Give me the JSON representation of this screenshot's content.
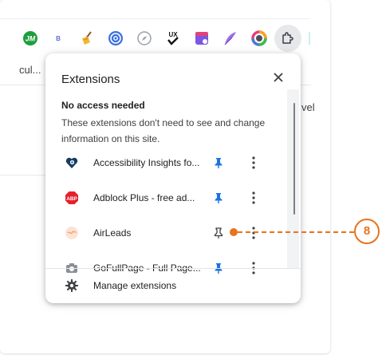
{
  "background_text": {
    "left_cut": "cul...",
    "right_cut": "vel"
  },
  "toolbar": {
    "icons": [
      {
        "name": "jm-extension-icon",
        "label": "JM",
        "color": "#1e9e3e"
      },
      {
        "name": "b-extension-icon",
        "label": "B",
        "color": "#5f6bd6"
      },
      {
        "name": "broom-extension-icon",
        "color": "#e0a21a"
      },
      {
        "name": "at-sign-extension-icon",
        "color": "#3b6fe0"
      },
      {
        "name": "compass-extension-icon",
        "color": "#9aa0a6"
      },
      {
        "name": "ux-check-extension-icon",
        "label": "UX",
        "color": "#111111"
      },
      {
        "name": "calendar-extension-icon",
        "color": "#7b57e4"
      },
      {
        "name": "feather-extension-icon",
        "color": "#8a5cd6"
      },
      {
        "name": "color-ring-extension-icon",
        "color": "#e4407c"
      }
    ],
    "extensions_button_icon": "puzzle-icon"
  },
  "popup": {
    "title": "Extensions",
    "close_icon": "close-icon",
    "section_heading": "No access needed",
    "section_description": "These extensions don't need to see and change information on this site.",
    "extensions": [
      {
        "name": "Accessibility Insights fo...",
        "icon": "heart-magnifier-icon",
        "pinned": true
      },
      {
        "name": "Adblock Plus - free ad...",
        "icon": "abp-stop-icon",
        "pinned": true
      },
      {
        "name": "AirLeads",
        "icon": "airleads-icon",
        "pinned": false
      },
      {
        "name": "GoFullPage - Full Page...",
        "icon": "camera-icon",
        "pinned": true
      }
    ],
    "manage_label": "Manage extensions",
    "manage_icon": "gear-icon"
  },
  "callout": {
    "number": "8",
    "color": "#e8731e"
  },
  "colors": {
    "pin_active": "#1a73e8",
    "pin_inactive": "#3c4043",
    "text_primary": "#202124"
  }
}
